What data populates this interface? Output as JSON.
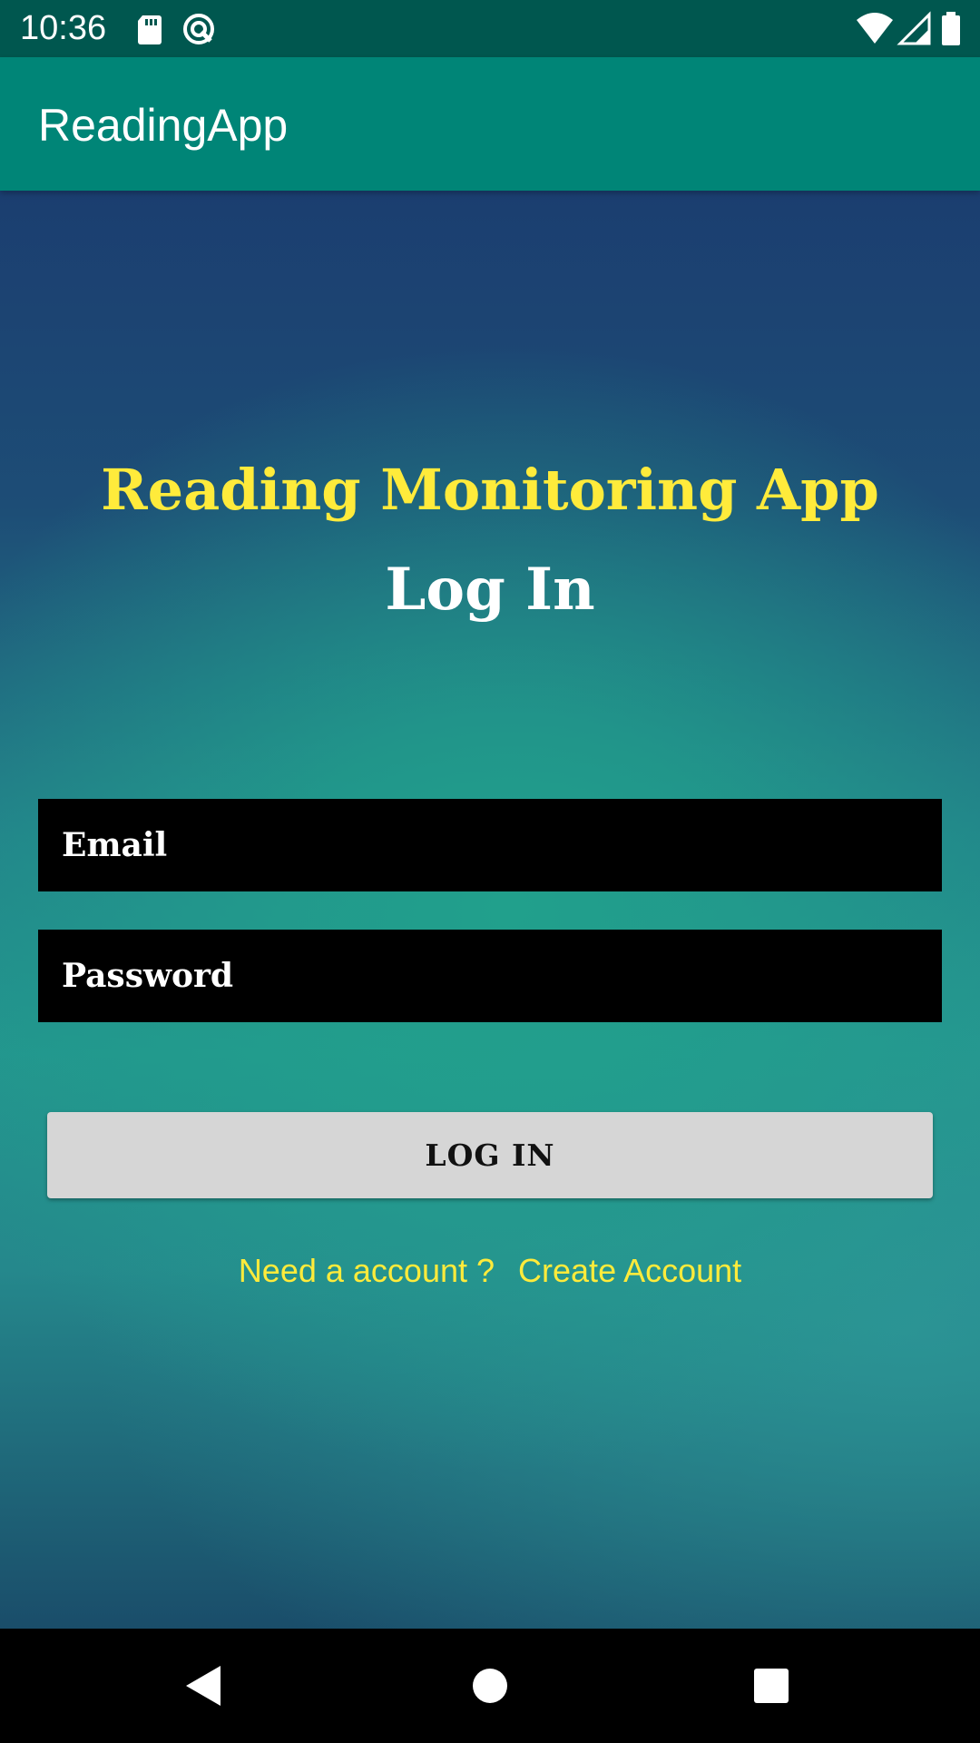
{
  "status_bar": {
    "time": "10:36",
    "icons": [
      "sd-card-icon",
      "vpn-key-icon",
      "wifi-icon",
      "signal-icon",
      "battery-icon"
    ]
  },
  "app_bar": {
    "title": "ReadingApp"
  },
  "login": {
    "app_heading": "Reading Monitoring App",
    "screen_heading": "Log In",
    "email_placeholder": "Email",
    "password_placeholder": "Password",
    "button_label": "LOG IN",
    "account_prompt": "Need a account ?",
    "create_account_label": "Create Account"
  },
  "nav_bar": {
    "icons": [
      "back-icon",
      "home-icon",
      "recents-icon"
    ]
  },
  "colors": {
    "status_bar": "#00574f",
    "app_bar": "#008577",
    "accent_yellow": "#ffeb3b",
    "field_background": "#000000",
    "button_background": "#d6d6d6"
  }
}
